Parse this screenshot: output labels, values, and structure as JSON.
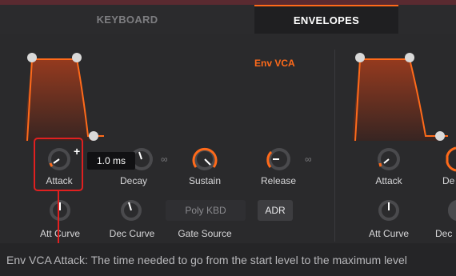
{
  "tabs": {
    "keyboard": "KEYBOARD",
    "envelopes": "ENVELOPES",
    "active": "ENVELOPES"
  },
  "env_vca": {
    "title": "Env VCA",
    "knobs": {
      "attack": "Attack",
      "decay": "Decay",
      "sustain": "Sustain",
      "release": "Release",
      "att_curve": "Att Curve",
      "dec_curve": "Dec Curve",
      "gate_source": "Gate Source"
    },
    "tooltip": "1.0 ms",
    "buttons": {
      "poly_kbd": "Poly KBD",
      "adr": "ADR"
    }
  },
  "env_right": {
    "knobs": {
      "attack": "Attack",
      "decay_partial": "De",
      "att_curve": "Att Curve",
      "dec_curve_partial": "Dec"
    }
  },
  "status_bar": {
    "text": "Env VCA Attack: The time needed to go from the start level to the maximum level"
  },
  "colors": {
    "accent": "#ff6a1a",
    "highlight": "#e02020",
    "panel": "#2a2a2c"
  },
  "icons": [
    "plus-icon",
    "link-icon",
    "arrow-down-icon"
  ]
}
